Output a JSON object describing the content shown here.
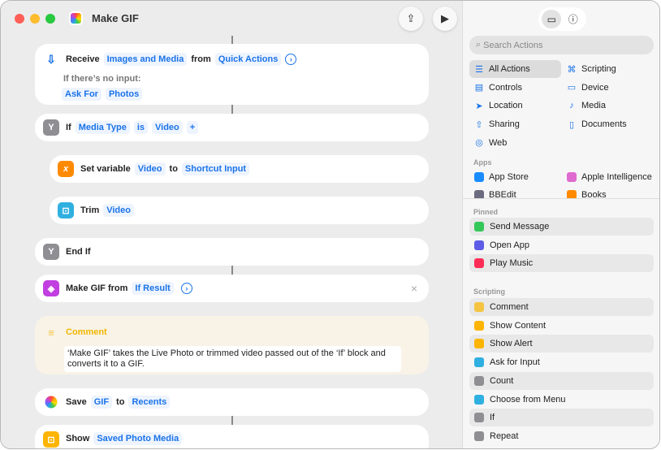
{
  "window": {
    "title": "Make GIF"
  },
  "editor": {
    "receive": {
      "verb": "Receive",
      "input": "Images and Media",
      "from": "from",
      "source": "Quick Actions",
      "no_input_label": "If there’s no input:",
      "fallback_action": "Ask For",
      "fallback_value": "Photos"
    },
    "if": {
      "verb": "If",
      "var": "Media Type",
      "op": "is",
      "value": "Video",
      "add": "+"
    },
    "set_variable": {
      "verb": "Set variable",
      "name": "Video",
      "to": "to",
      "value": "Shortcut Input"
    },
    "trim": {
      "verb": "Trim",
      "value": "Video"
    },
    "end_if": {
      "verb": "End If"
    },
    "make_gif": {
      "verb": "Make GIF from",
      "value": "If Result",
      "close": "×"
    },
    "comment": {
      "label": "Comment",
      "text": "‘Make GIF’ takes the Live Photo or trimmed video passed out of the ‘If’ block and converts it to a GIF."
    },
    "save": {
      "verb": "Save",
      "value": "GIF",
      "to": "to",
      "album": "Recents"
    },
    "show": {
      "verb": "Show",
      "value": "Saved Photo Media"
    }
  },
  "panel": {
    "search_placeholder": "Search Actions",
    "categories": [
      {
        "label": "All Actions",
        "icon": "list-icon",
        "glyph": "☰",
        "selected": true
      },
      {
        "label": "Scripting",
        "icon": "scripting-icon",
        "glyph": "⌘"
      },
      {
        "label": "Controls",
        "icon": "controls-icon",
        "glyph": "▤"
      },
      {
        "label": "Device",
        "icon": "device-icon",
        "glyph": "▭"
      },
      {
        "label": "Location",
        "icon": "location-icon",
        "glyph": "➤"
      },
      {
        "label": "Media",
        "icon": "music-note-icon",
        "glyph": "♪"
      },
      {
        "label": "Sharing",
        "icon": "share-icon",
        "glyph": "⇧"
      },
      {
        "label": "Documents",
        "icon": "document-icon",
        "glyph": "▯"
      },
      {
        "label": "Web",
        "icon": "compass-icon",
        "glyph": "◎"
      }
    ],
    "apps_label": "Apps",
    "apps": [
      {
        "label": "App Store",
        "icon": "app-store-icon",
        "color": "#1a8cff"
      },
      {
        "label": "Apple Intelligence",
        "icon": "apple-intelligence-icon",
        "color": "#e06bd0"
      },
      {
        "label": "BBEdit",
        "icon": "bbedit-icon",
        "color": "#6b6b80"
      },
      {
        "label": "Books",
        "icon": "books-icon",
        "color": "#ff8a00"
      }
    ],
    "pinned_label": "Pinned",
    "pinned": [
      {
        "label": "Send Message",
        "icon": "message-icon",
        "color": "#34c759"
      },
      {
        "label": "Open App",
        "icon": "open-app-icon",
        "color": "#5e5ce6"
      },
      {
        "label": "Play Music",
        "icon": "music-icon",
        "color": "#ff2d55"
      }
    ],
    "scripting_label": "Scripting",
    "scripting": [
      {
        "label": "Comment",
        "icon": "comment-icon",
        "color": "#f5c542"
      },
      {
        "label": "Show Content",
        "icon": "show-content-icon",
        "color": "#ffb400"
      },
      {
        "label": "Show Alert",
        "icon": "alert-icon",
        "color": "#ffb400"
      },
      {
        "label": "Ask for Input",
        "icon": "ask-input-icon",
        "color": "#30b0e0"
      },
      {
        "label": "Count",
        "icon": "count-icon",
        "color": "#8e8e93"
      },
      {
        "label": "Choose from Menu",
        "icon": "menu-icon",
        "color": "#30b0e0"
      },
      {
        "label": "If",
        "icon": "if-icon",
        "color": "#8e8e93"
      },
      {
        "label": "Repeat",
        "icon": "repeat-icon",
        "color": "#8e8e93"
      }
    ]
  }
}
